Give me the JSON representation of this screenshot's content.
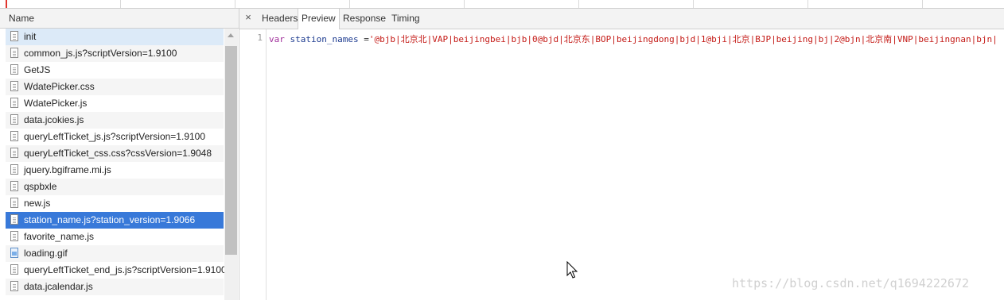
{
  "list": {
    "header": "Name",
    "rows": [
      {
        "name": "init",
        "icon": "file-icon"
      },
      {
        "name": "common_js.js?scriptVersion=1.9100",
        "icon": "file-icon"
      },
      {
        "name": "GetJS",
        "icon": "file-icon"
      },
      {
        "name": "WdatePicker.css",
        "icon": "file-icon"
      },
      {
        "name": "WdatePicker.js",
        "icon": "file-icon"
      },
      {
        "name": "data.jcokies.js",
        "icon": "file-icon"
      },
      {
        "name": "queryLeftTicket_js.js?scriptVersion=1.9100",
        "icon": "file-icon"
      },
      {
        "name": "queryLeftTicket_css.css?cssVersion=1.9048",
        "icon": "file-icon"
      },
      {
        "name": "jquery.bgiframe.mi.js",
        "icon": "file-icon"
      },
      {
        "name": "qspbxle",
        "icon": "file-icon"
      },
      {
        "name": "new.js",
        "icon": "file-icon"
      },
      {
        "name": "station_name.js?station_version=1.9066",
        "icon": "file-icon"
      },
      {
        "name": "favorite_name.js",
        "icon": "file-icon"
      },
      {
        "name": "loading.gif",
        "icon": "image-file-icon"
      },
      {
        "name": "queryLeftTicket_end_js.js?scriptVersion=1.9100",
        "icon": "file-icon"
      },
      {
        "name": "data.jcalendar.js",
        "icon": "file-icon"
      }
    ],
    "selected_index": 11,
    "hover_index": 0
  },
  "tabs": {
    "close": "×",
    "items": [
      "Headers",
      "Preview",
      "Response",
      "Timing"
    ],
    "active": "Preview"
  },
  "preview": {
    "line_number": "1",
    "keyword": "var",
    "variable": "station_names",
    "operator": "=",
    "string": "'@bjb|北京北|VAP|beijingbei|bjb|0@bjd|北京东|BOP|beijingdong|bjd|1@bji|北京|BJP|beijing|bj|2@bjn|北京南|VNP|beijingnan|bjn|"
  },
  "watermark": "https://blog.csdn.net/q1694222672",
  "colors": {
    "selection": "#3879d9",
    "hover": "#dceaf8",
    "string": "#c41a16",
    "keyword": "#a0309b"
  }
}
